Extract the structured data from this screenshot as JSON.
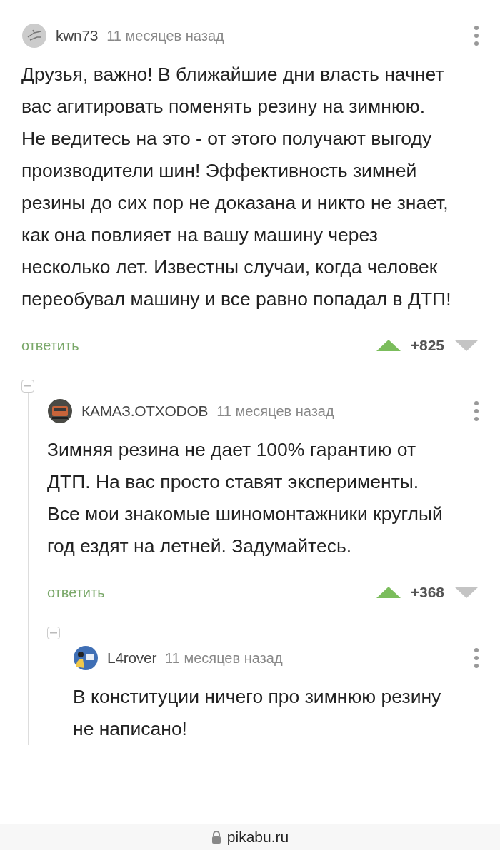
{
  "comments": [
    {
      "author": "kwn73",
      "time": "11 месяцев назад",
      "text": "Друзья, важно! В ближайшие дни власть начнет вас агитировать поменять резину на зимнюю. Не ведитесь на это - от этого получают выгоду производители шин! Эффективность зимней резины до сих пор не доказана и никто не знает, как она повлияет на вашу машину через несколько лет. Известны случаи, когда человек переобувал машину и все равно попадал в ДТП!",
      "reply": "ответить",
      "rating": "+825",
      "children": [
        {
          "author": "КАМАЗ.OTXODOB",
          "time": "11 месяцев назад",
          "text": "Зимняя резина не дает 100% гарантию от ДТП. На вас просто ставят эксперименты. Все мои знакомые шиномонтажники круглый год ездят на летней. Задумайтесь.",
          "reply": "ответить",
          "rating": "+368",
          "children": [
            {
              "author": "L4rover",
              "time": "11 месяцев назад",
              "text": "В конституции ничего про зимнюю резину не написано!"
            }
          ]
        }
      ]
    }
  ],
  "address_bar": {
    "url": "pikabu.ru"
  }
}
